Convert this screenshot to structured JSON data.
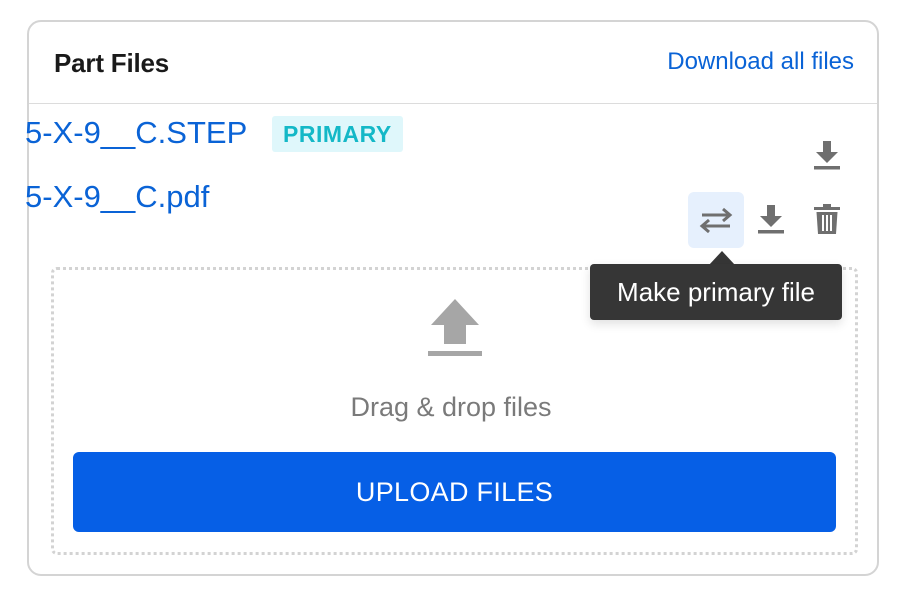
{
  "header": {
    "title": "Part Files",
    "download_all_label": "Download all files"
  },
  "files": [
    {
      "name": "5-X-9__C.STEP",
      "badge": "PRIMARY",
      "actions": [
        "download-icon"
      ]
    },
    {
      "name": "5-X-9__C.pdf",
      "actions": [
        "swap-icon",
        "download-icon",
        "trash-icon"
      ]
    }
  ],
  "tooltip": {
    "text": "Make primary file"
  },
  "dropzone": {
    "icon": "upload-icon",
    "text": "Drag & drop files",
    "button_label": "UPLOAD FILES"
  },
  "colors": {
    "link": "#0a63d6",
    "badge_bg": "#dff7fb",
    "badge_text": "#14b8c7",
    "button_bg": "#065fe6",
    "tooltip_bg": "#363636",
    "icon_gray": "#6f6f6f",
    "active_bg": "#e6f0fd"
  }
}
